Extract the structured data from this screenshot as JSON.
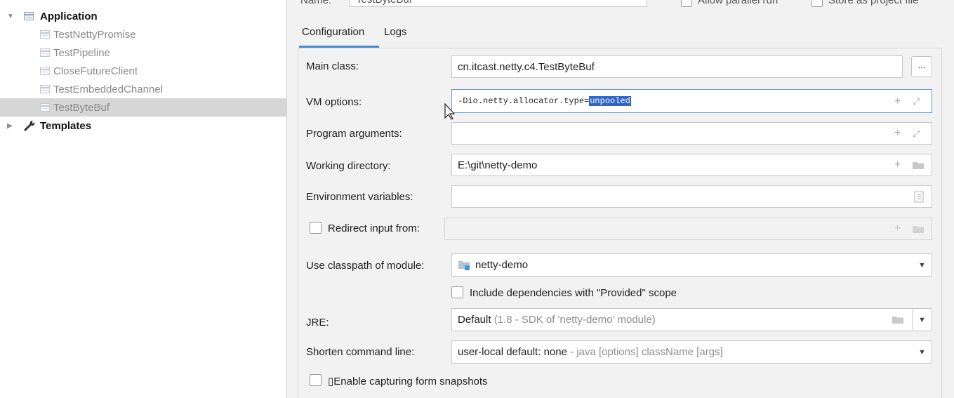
{
  "tree": {
    "top_clipped_text": "Name:",
    "application": {
      "label": "Application"
    },
    "items": [
      {
        "label": "TestNettyPromise",
        "selected": false
      },
      {
        "label": "TestPipeline",
        "selected": false
      },
      {
        "label": "CloseFutureClient",
        "selected": false
      },
      {
        "label": "TestEmbeddedChannel",
        "selected": false
      },
      {
        "label": "TestByteBuf",
        "selected": true
      }
    ],
    "templates": {
      "label": "Templates"
    }
  },
  "header": {
    "name_label": "Name:",
    "name_value": "TestByteBuf",
    "allow_parallel_label": "Allow parallel run",
    "store_project_label": "Store as project file"
  },
  "tabs": [
    {
      "label": "Configuration",
      "active": true
    },
    {
      "label": "Logs",
      "active": false
    }
  ],
  "form": {
    "main_class": {
      "label": "Main class:",
      "value": "cn.itcast.netty.c4.TestByteBuf",
      "button": "..."
    },
    "vm_options": {
      "label": "VM options:",
      "value_prefix": "-Dio.netty.allocator.type=",
      "value_selected": "unpooled"
    },
    "program_arguments": {
      "label": "Program arguments:",
      "value": ""
    },
    "working_directory": {
      "label": "Working directory:",
      "value": "E:\\git\\netty-demo"
    },
    "environment_variables": {
      "label": "Environment variables:",
      "value": ""
    },
    "redirect_input": {
      "label": "Redirect input from:",
      "checked": false,
      "value": ""
    },
    "classpath_module": {
      "label": "Use classpath of module:",
      "value": "netty-demo"
    },
    "include_provided": {
      "label": "Include dependencies with \"Provided\" scope",
      "checked": false
    },
    "jre": {
      "label": "JRE:",
      "value": "Default",
      "hint": "(1.8 - SDK of 'netty-demo' module)"
    },
    "shorten_command_line": {
      "label": "Shorten command line:",
      "value": "user-local default: none",
      "hint": "- java [options] className [args]"
    },
    "capture_snapshots": {
      "label": "▯Enable capturing form snapshots",
      "checked": false
    }
  },
  "icons": {
    "add": "+",
    "expand": "⤢",
    "dropdown": "▼",
    "caret_down": "▼",
    "caret_right": "▶"
  },
  "colors": {
    "selection": "#2f65ca",
    "tab_accent": "#4a89c9",
    "selected_row": "#d6d6d6"
  }
}
